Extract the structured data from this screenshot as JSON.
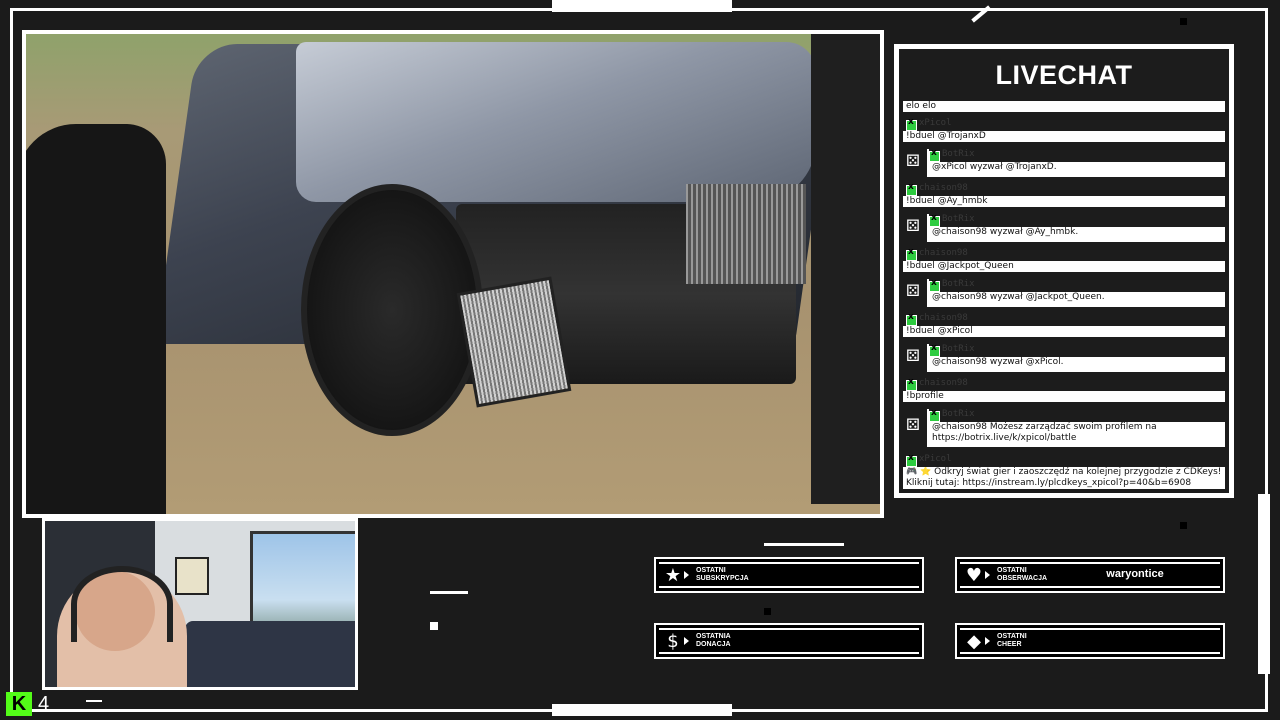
{
  "chat": {
    "title": "LIVECHAT",
    "messages": [
      {
        "type": "text",
        "text": "elo elo"
      },
      {
        "type": "user",
        "user": "xPicol",
        "text": "!bduel @TrojanxD"
      },
      {
        "type": "bot",
        "user": "BotRix",
        "text": "@xPicol wyzwał @TrojanxD."
      },
      {
        "type": "user",
        "user": "chaison98",
        "text": "!bduel @Ay_hmbk"
      },
      {
        "type": "bot",
        "user": "BotRix",
        "text": "@chaison98 wyzwał @Ay_hmbk."
      },
      {
        "type": "user",
        "user": "chaison98",
        "text": "!bduel @Jackpot_Queen"
      },
      {
        "type": "bot",
        "user": "BotRix",
        "text": "@chaison98 wyzwał @Jackpot_Queen."
      },
      {
        "type": "user",
        "user": "chaison98",
        "text": "!bduel @xPicol"
      },
      {
        "type": "bot",
        "user": "BotRix",
        "text": "@chaison98 wyzwał @xPicol."
      },
      {
        "type": "user",
        "user": "chaison98",
        "text": "!bprofile"
      },
      {
        "type": "bot",
        "user": "BotRix",
        "text": "@chaison98 Możesz zarządzać swoim profilem na https://botrix.live/k/xpicol/battle"
      },
      {
        "type": "user",
        "user": "xPicol",
        "text": "🎮 ⭐ Odkryj świat gier i zaoszczędź na kolejnej przygodzie z CDKeys! Kliknij tutaj: https://instream.ly/plcdkeys_xpicol?p=40&b=6908"
      }
    ]
  },
  "alerts": {
    "sub": {
      "label_line1": "OSTATNI",
      "label_line2": "SUBSKRYPCJA",
      "value": "",
      "icon": "star-icon"
    },
    "follow": {
      "label_line1": "OSTATNI",
      "label_line2": "OBSERWACJA",
      "value": "waryontice",
      "icon": "heart-icon"
    },
    "donation": {
      "label_line1": "OSTATNIA",
      "label_line2": "DONACJA",
      "value": "",
      "icon": "dollar-icon"
    },
    "cheer": {
      "label_line1": "OSTATNI",
      "label_line2": "CHEER",
      "value": "",
      "icon": "diamond-icon"
    }
  },
  "footer": {
    "platform_logo": "K",
    "viewer_count": "4"
  },
  "colors": {
    "kick_green": "#53fc18",
    "badge_green": "#2ecc40",
    "frame": "#1b1b1b"
  }
}
